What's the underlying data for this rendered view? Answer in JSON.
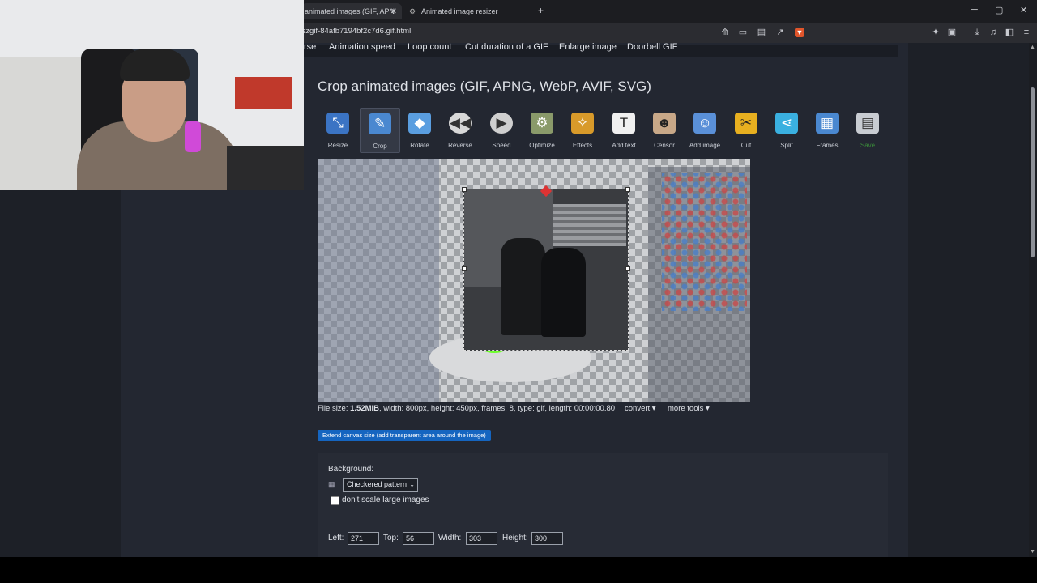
{
  "browser": {
    "tab_active": "animated images (GIF, APN",
    "tab_other": "Animated image resizer",
    "new_tab": "+",
    "url": "ezgif-84afb7194bf2c7d6.gif.html",
    "controls": {
      "minimize": "─",
      "maximize": "▢",
      "close": "✕"
    }
  },
  "nav": {
    "links": [
      "rse",
      "Animation speed",
      "Loop count",
      "Cut duration of a GIF",
      "Enlarge image",
      "Doorbell GIF"
    ]
  },
  "page": {
    "title": "Crop animated images (GIF, APNG, WebP, AVIF, SVG)"
  },
  "tools": [
    {
      "label": "Resize",
      "icon": "resize-icon"
    },
    {
      "label": "Crop",
      "icon": "crop-icon"
    },
    {
      "label": "Rotate",
      "icon": "rotate-icon"
    },
    {
      "label": "Reverse",
      "icon": "reverse-icon"
    },
    {
      "label": "Speed",
      "icon": "speed-icon"
    },
    {
      "label": "Optimize",
      "icon": "optimize-icon"
    },
    {
      "label": "Effects",
      "icon": "effects-icon"
    },
    {
      "label": "Add text",
      "icon": "add-text-icon"
    },
    {
      "label": "Censor",
      "icon": "censor-icon"
    },
    {
      "label": "Add image",
      "icon": "add-image-icon"
    },
    {
      "label": "Cut",
      "icon": "scissors-icon"
    },
    {
      "label": "Split",
      "icon": "split-icon"
    },
    {
      "label": "Frames",
      "icon": "frames-icon"
    },
    {
      "label": "Save",
      "icon": "save-icon"
    }
  ],
  "fileinfo": {
    "prefix": "File size: ",
    "size": "1.52MiB",
    "rest": ", width: 800px, height: 450px, frames: 8, type: gif, length: 00:00:00.80",
    "convert": "convert ▾",
    "more_tools": "more tools ▾"
  },
  "extend_button": "Extend canvas size (add transparent area around the image)",
  "background": {
    "label": "Background:",
    "selected": "Checkered pattern",
    "dont_scale": "don't scale large images"
  },
  "crop_fields": {
    "left_label": "Left:",
    "left": "271",
    "top_label": "Top:",
    "top": "56",
    "width_label": "Width:",
    "width": "303",
    "height_label": "Height:",
    "height": "300"
  }
}
